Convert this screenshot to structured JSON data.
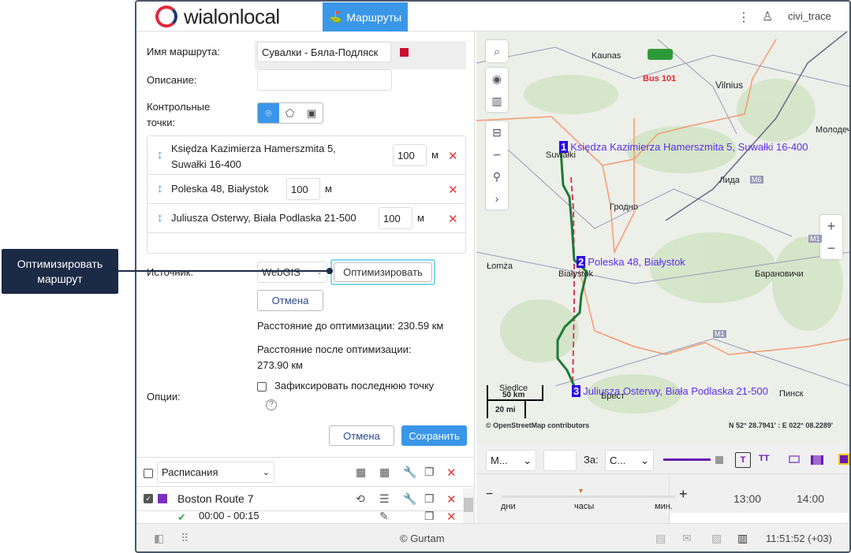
{
  "header": {
    "app_name": "wialonlocal",
    "tab": "Маршруты",
    "username": "civi_trace"
  },
  "form": {
    "name_label": "Имя маршрута:",
    "name_value": "Сувалки - Бяла-Подляск",
    "route_color": "#c8102e",
    "desc_label": "Описание:",
    "desc_value": "",
    "checkpoints_label_1": "Контрольные",
    "checkpoints_label_2": "точки:",
    "checkpoints": [
      {
        "address_1": "Księdza Kazimierza Hamerszmita 5,",
        "address_2": "Suwałki 16-400",
        "radius": "100",
        "unit": "м"
      },
      {
        "address_1": "Poleska 48, Białystok",
        "radius": "100",
        "unit": "м"
      },
      {
        "address_1": "Juliusza Osterwy, Biała Podlaska 21-500",
        "radius": "100",
        "unit": "м"
      }
    ],
    "source_label": "Источник:",
    "source_value": "WebGIS",
    "optimize_button": "Оптимизировать",
    "cancel_opt_button": "Отмена",
    "dist_before": "Расстояние до оптимизации: 230.59 км",
    "dist_after_1": "Расстояние после оптимизации:",
    "dist_after_2": "273.90 км",
    "options_label": "Опции:",
    "fix_last_point": "Зафиксировать последнюю точку",
    "cancel_button": "Отмена",
    "save_button": "Сохранить"
  },
  "list": {
    "filter": "Расписания",
    "route_name": "Boston Route 7",
    "route_color": "#7b2fbf",
    "schedule": "00:00 - 00:15"
  },
  "map": {
    "cities": [
      "Kaunas",
      "Vilnius",
      "Молодеч",
      "Suwałki",
      "Лида",
      "Гродно",
      "Łomża",
      "Białystok",
      "Барановичи",
      "Siedlce",
      "Брест",
      "Пинск"
    ],
    "roads": [
      "M6",
      "M1",
      "M1"
    ],
    "unit_label": "Bus 101",
    "waypoints": [
      {
        "n": "1",
        "label": "Księdza Kazimierza Hamerszmita 5, Suwałki 16-400"
      },
      {
        "n": "2",
        "label": "Poleska 48, Białystok"
      },
      {
        "n": "3",
        "label": "Juliusza Osterwy, Biała Podlaska 21-500"
      }
    ],
    "scale_km": "50 km",
    "scale_mi": "20 mi",
    "attribution": "© OpenStreetMap contributors",
    "coords": "N 52° 28.7941' : E 022° 08.2289'"
  },
  "toolbar": {
    "select1": "М...",
    "for_label": "За:",
    "select2": "С..."
  },
  "timeline": {
    "days": "дни",
    "hours": "часы",
    "minutes": "мин.",
    "t1": "13:00",
    "t2": "14:00"
  },
  "status": {
    "copyright": "© Gurtam",
    "time": "11:51:52 (+03)"
  },
  "callout": {
    "text_1": "Оптимизировать",
    "text_2": "маршрут"
  }
}
